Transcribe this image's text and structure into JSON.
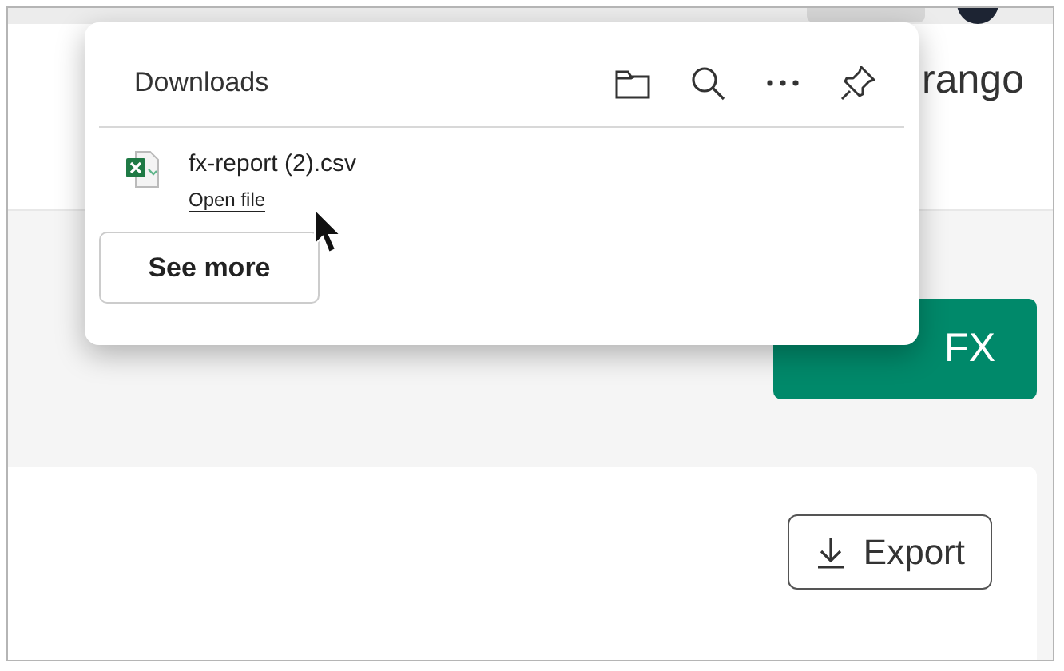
{
  "page": {
    "heading_fragment": "rango",
    "trade_button": "FX",
    "export_button": "Export"
  },
  "downloads": {
    "title": "Downloads",
    "files": [
      {
        "name": "fx-report (2).csv",
        "action": "Open file"
      }
    ],
    "see_more": "See more"
  }
}
